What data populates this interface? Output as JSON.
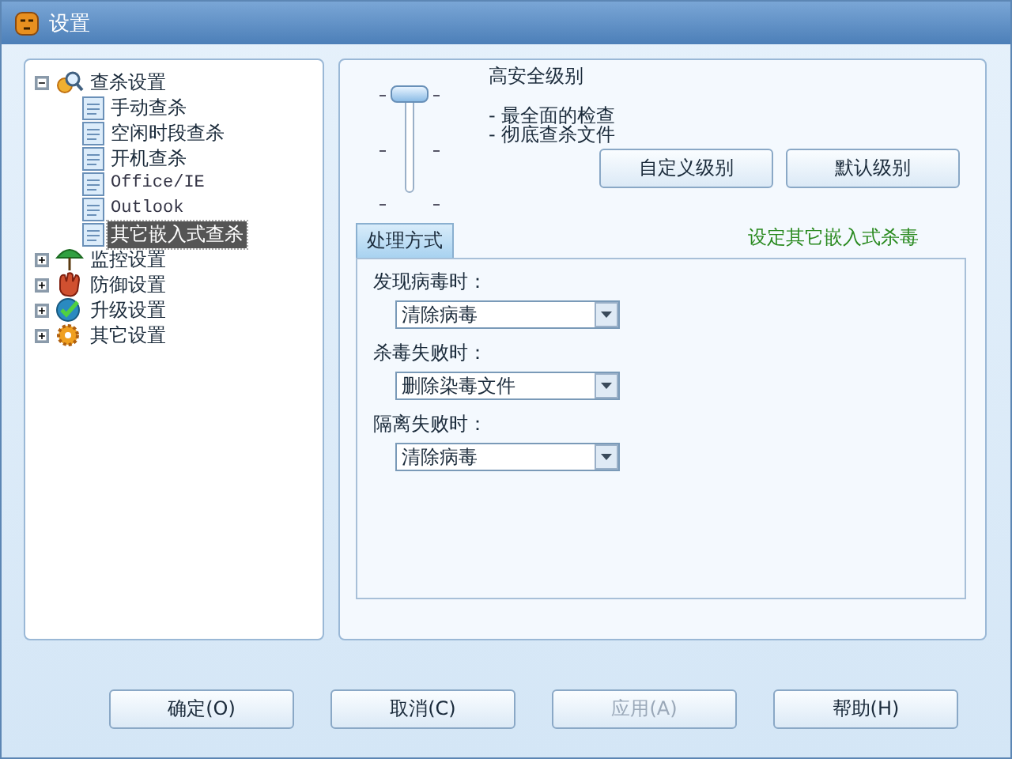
{
  "window": {
    "title": "设置"
  },
  "tree": [
    {
      "label": "查杀设置",
      "expanded": true,
      "selected": false,
      "children": [
        {
          "label": "手动查杀",
          "selected": false
        },
        {
          "label": "空闲时段查杀",
          "selected": false
        },
        {
          "label": "开机查杀",
          "selected": false
        },
        {
          "label": "Office/IE",
          "selected": false
        },
        {
          "label": "Outlook",
          "selected": false
        },
        {
          "label": "其它嵌入式查杀",
          "selected": true
        }
      ]
    },
    {
      "label": "监控设置",
      "expanded": false,
      "selected": false
    },
    {
      "label": "防御设置",
      "expanded": false,
      "selected": false
    },
    {
      "label": "升级设置",
      "expanded": false,
      "selected": false
    },
    {
      "label": "其它设置",
      "expanded": false,
      "selected": false
    }
  ],
  "level": {
    "title": "高安全级别",
    "level": 1,
    "points": [
      "- 最全面的检查",
      "- 彻底查杀文件"
    ],
    "buttons": [
      "自定义级别",
      "默认级别"
    ]
  },
  "group": {
    "tab": "处理方式",
    "note": "设定其它嵌入式杀毒",
    "fields": [
      {
        "label": "发现病毒时：",
        "value": "清除病毒"
      },
      {
        "label": "杀毒失败时：",
        "value": "删除染毒文件"
      },
      {
        "label": "隔离失败时：",
        "value": "清除病毒"
      }
    ]
  },
  "buttons": [
    {
      "label": "确定(O)",
      "disabled": false
    },
    {
      "label": "取消(C)",
      "disabled": false
    },
    {
      "label": "应用(A)",
      "disabled": true
    },
    {
      "label": "帮助(H)",
      "disabled": false
    }
  ]
}
